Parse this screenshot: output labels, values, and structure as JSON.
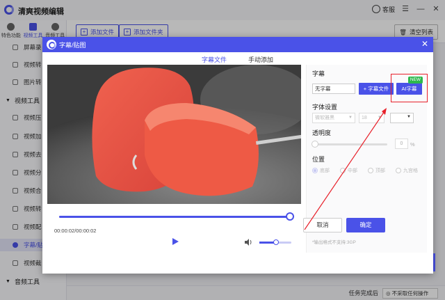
{
  "app": {
    "title": "清爽视频编辑",
    "service_label": "客服",
    "minimize_glyph": "—",
    "menu_glyph": "☰",
    "close_glyph": "✕"
  },
  "sidebar": {
    "tabs": [
      {
        "label": "特色功能",
        "icon": "star-icon"
      },
      {
        "label": "视频工具",
        "icon": "video-icon"
      },
      {
        "label": "音频工具",
        "icon": "audio-icon"
      }
    ],
    "items_top": [
      {
        "label": "屏幕录",
        "icon": "screen-record-icon"
      },
      {
        "label": "视频转",
        "icon": "video-convert-icon"
      },
      {
        "label": "图片转",
        "icon": "image-convert-icon"
      }
    ],
    "group_video": "视频工具",
    "items_video": [
      {
        "label": "视频压",
        "icon": "compress-icon"
      },
      {
        "label": "视频加",
        "icon": "add-icon"
      },
      {
        "label": "视频去",
        "icon": "remove-icon"
      },
      {
        "label": "视频分",
        "icon": "split-icon"
      },
      {
        "label": "视频合",
        "icon": "merge-icon"
      },
      {
        "label": "视频转",
        "icon": "convert-icon"
      },
      {
        "label": "视频配",
        "icon": "dub-icon"
      },
      {
        "label": "字幕/贴",
        "icon": "subtitle-icon",
        "active": true
      },
      {
        "label": "视频截",
        "icon": "crop-icon"
      }
    ],
    "group_audio": "音频工具"
  },
  "toolbar": {
    "add_file": "添加文件",
    "add_folder": "添加文件夹",
    "clear_list": "清空列表"
  },
  "footer": {
    "label": "任务完成后",
    "select_value": "◎ 不采取任何操作"
  },
  "dialog": {
    "title": "字幕/贴图",
    "tabs": [
      "字幕文件",
      "手动添加"
    ],
    "active_tab": 0,
    "player": {
      "time": "00:00:02/00:00:02",
      "progress": 1.0,
      "volume": 0.5
    },
    "panel": {
      "subtitle_label": "字幕",
      "subtitle_value": "无字幕",
      "add_subtitle_button": "+ 字幕文件",
      "ai_button": "AI字幕",
      "new_badge": "NEW",
      "font_label": "字体设置",
      "font_family": "微软雅黑",
      "font_size": "18",
      "opacity_label": "透明度",
      "opacity_value": "0",
      "opacity_unit": "%",
      "position_label": "位置",
      "positions": [
        "底部",
        "中部",
        "顶部",
        "九宫格"
      ],
      "note": "*输出格式不支持:3GP"
    },
    "cancel": "取消",
    "ok": "确定"
  },
  "colors": {
    "accent": "#4a52e8",
    "highlight": "#e8202a",
    "new_badge": "#2db84d"
  }
}
